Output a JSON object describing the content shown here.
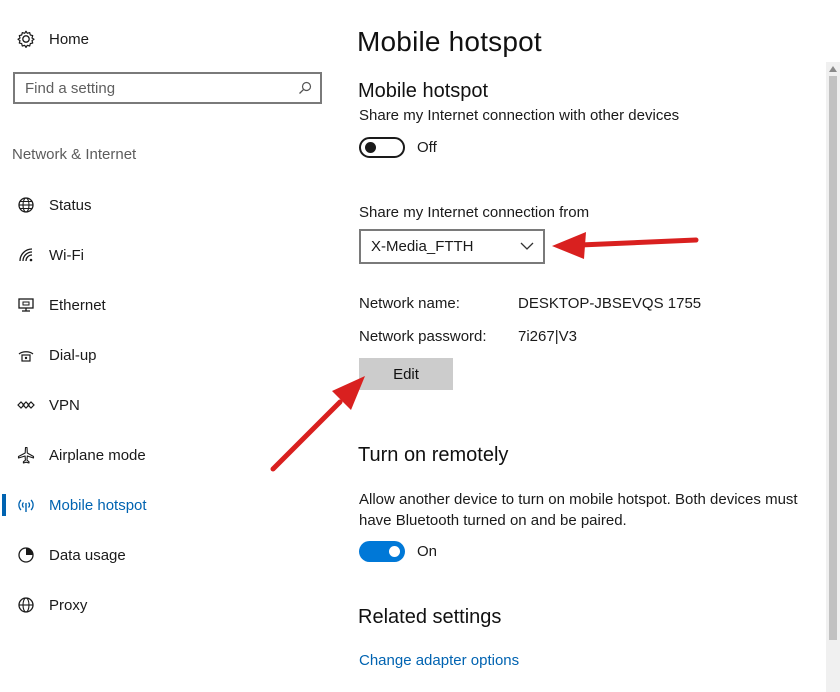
{
  "sidebar": {
    "home_label": "Home",
    "search_placeholder": "Find a setting",
    "section_label": "Network & Internet",
    "items": [
      {
        "label": "Status",
        "icon": "globe-status-icon"
      },
      {
        "label": "Wi-Fi",
        "icon": "wifi-icon"
      },
      {
        "label": "Ethernet",
        "icon": "ethernet-icon"
      },
      {
        "label": "Dial-up",
        "icon": "dialup-icon"
      },
      {
        "label": "VPN",
        "icon": "vpn-icon"
      },
      {
        "label": "Airplane mode",
        "icon": "airplane-icon"
      },
      {
        "label": "Mobile hotspot",
        "icon": "hotspot-icon",
        "active": true
      },
      {
        "label": "Data usage",
        "icon": "data-usage-icon"
      },
      {
        "label": "Proxy",
        "icon": "globe-proxy-icon"
      }
    ]
  },
  "main": {
    "page_title": "Mobile hotspot",
    "hotspot": {
      "heading": "Mobile hotspot",
      "description": "Share my Internet connection with other devices",
      "toggle_state": "Off"
    },
    "share_from": {
      "label": "Share my Internet connection from",
      "selected": "X-Media_FTTH"
    },
    "network": {
      "name_label": "Network name:",
      "name_value": "DESKTOP-JBSEVQS 1755",
      "password_label": "Network password:",
      "password_value": "7i267|V3",
      "edit_label": "Edit"
    },
    "remote": {
      "heading": "Turn on remotely",
      "description": "Allow another device to turn on mobile hotspot. Both devices must have Bluetooth turned on and be paired.",
      "toggle_state": "On"
    },
    "related": {
      "heading": "Related settings",
      "link": "Change adapter options"
    }
  },
  "colors": {
    "accent": "#0078d7",
    "link": "#0063b1",
    "annotation_arrow": "#d9201f"
  }
}
